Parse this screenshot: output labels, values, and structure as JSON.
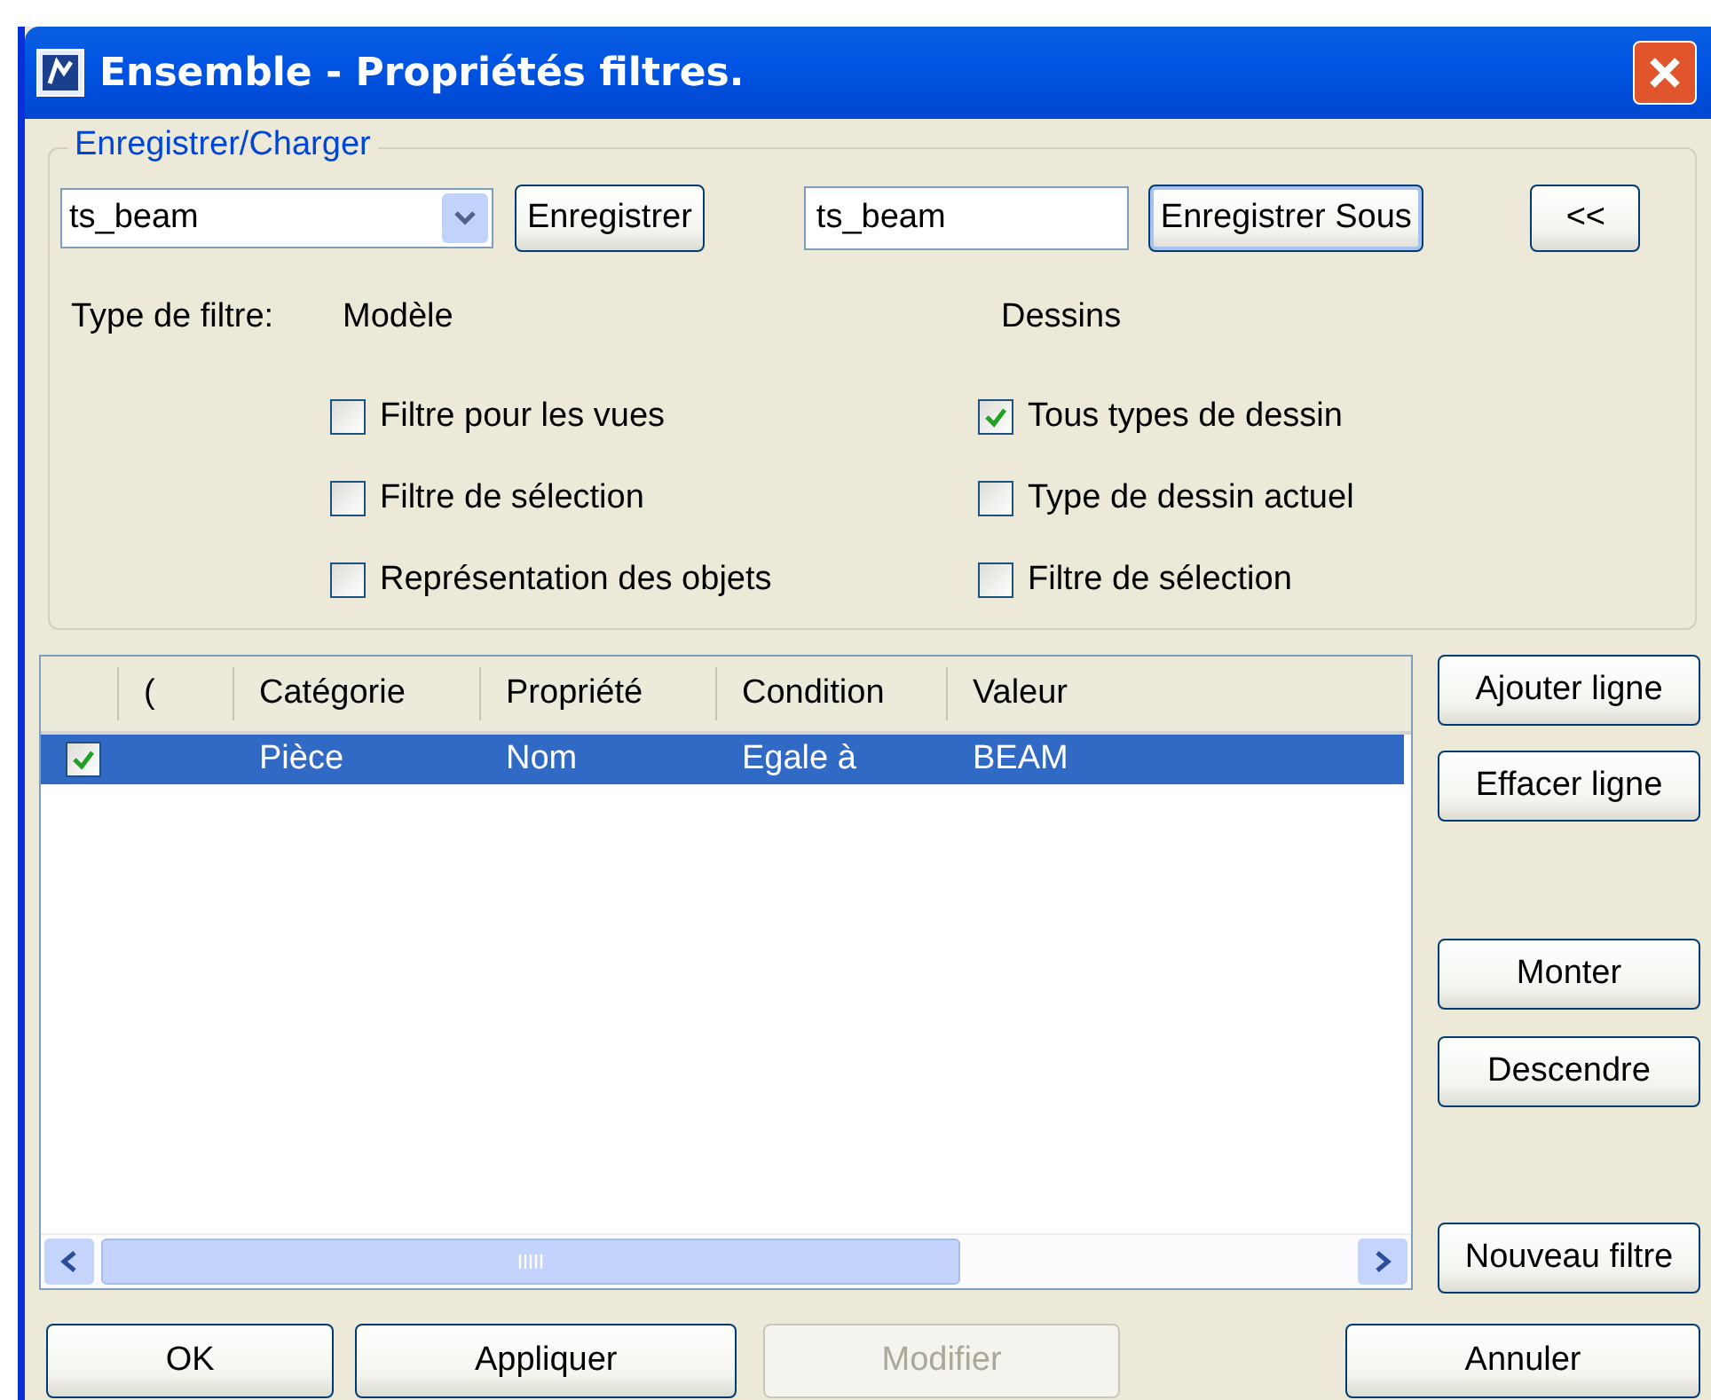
{
  "window": {
    "title": "Ensemble - Propriétés filtres."
  },
  "save_load": {
    "legend": "Enregistrer/Charger",
    "preset_combo": {
      "value": "ts_beam"
    },
    "save_button": "Enregistrer",
    "name_field": {
      "value": "ts_beam"
    },
    "save_as_button": "Enregistrer Sous",
    "collapse_button": "<<"
  },
  "filter_type": {
    "label": "Type de filtre:",
    "model_heading": "Modèle",
    "drawings_heading": "Dessins",
    "model_options": [
      {
        "label": "Filtre pour les vues",
        "checked": false
      },
      {
        "label": "Filtre de sélection",
        "checked": false
      },
      {
        "label": "Représentation des objets",
        "checked": false
      }
    ],
    "drawing_options": [
      {
        "label": "Tous types de dessin",
        "checked": true
      },
      {
        "label": "Type de dessin actuel",
        "checked": false
      },
      {
        "label": "Filtre de sélection",
        "checked": false
      }
    ]
  },
  "table": {
    "columns": [
      "(",
      "Catégorie",
      "Propriété",
      "Condition",
      "Valeur"
    ],
    "rows": [
      {
        "checked": true,
        "selected": true,
        "category": "Pièce",
        "property": "Nom",
        "condition": "Egale à",
        "value": "BEAM"
      }
    ]
  },
  "side_buttons": [
    {
      "label": "Ajouter ligne"
    },
    {
      "label": "Effacer ligne"
    },
    {
      "label": "Monter"
    },
    {
      "label": "Descendre"
    },
    {
      "label": "Nouveau filtre"
    }
  ],
  "footer_buttons": [
    {
      "label": "OK",
      "disabled": false
    },
    {
      "label": "Appliquer",
      "disabled": false
    },
    {
      "label": "Modifier",
      "disabled": true
    },
    {
      "label": "Annuler",
      "disabled": false
    }
  ]
}
